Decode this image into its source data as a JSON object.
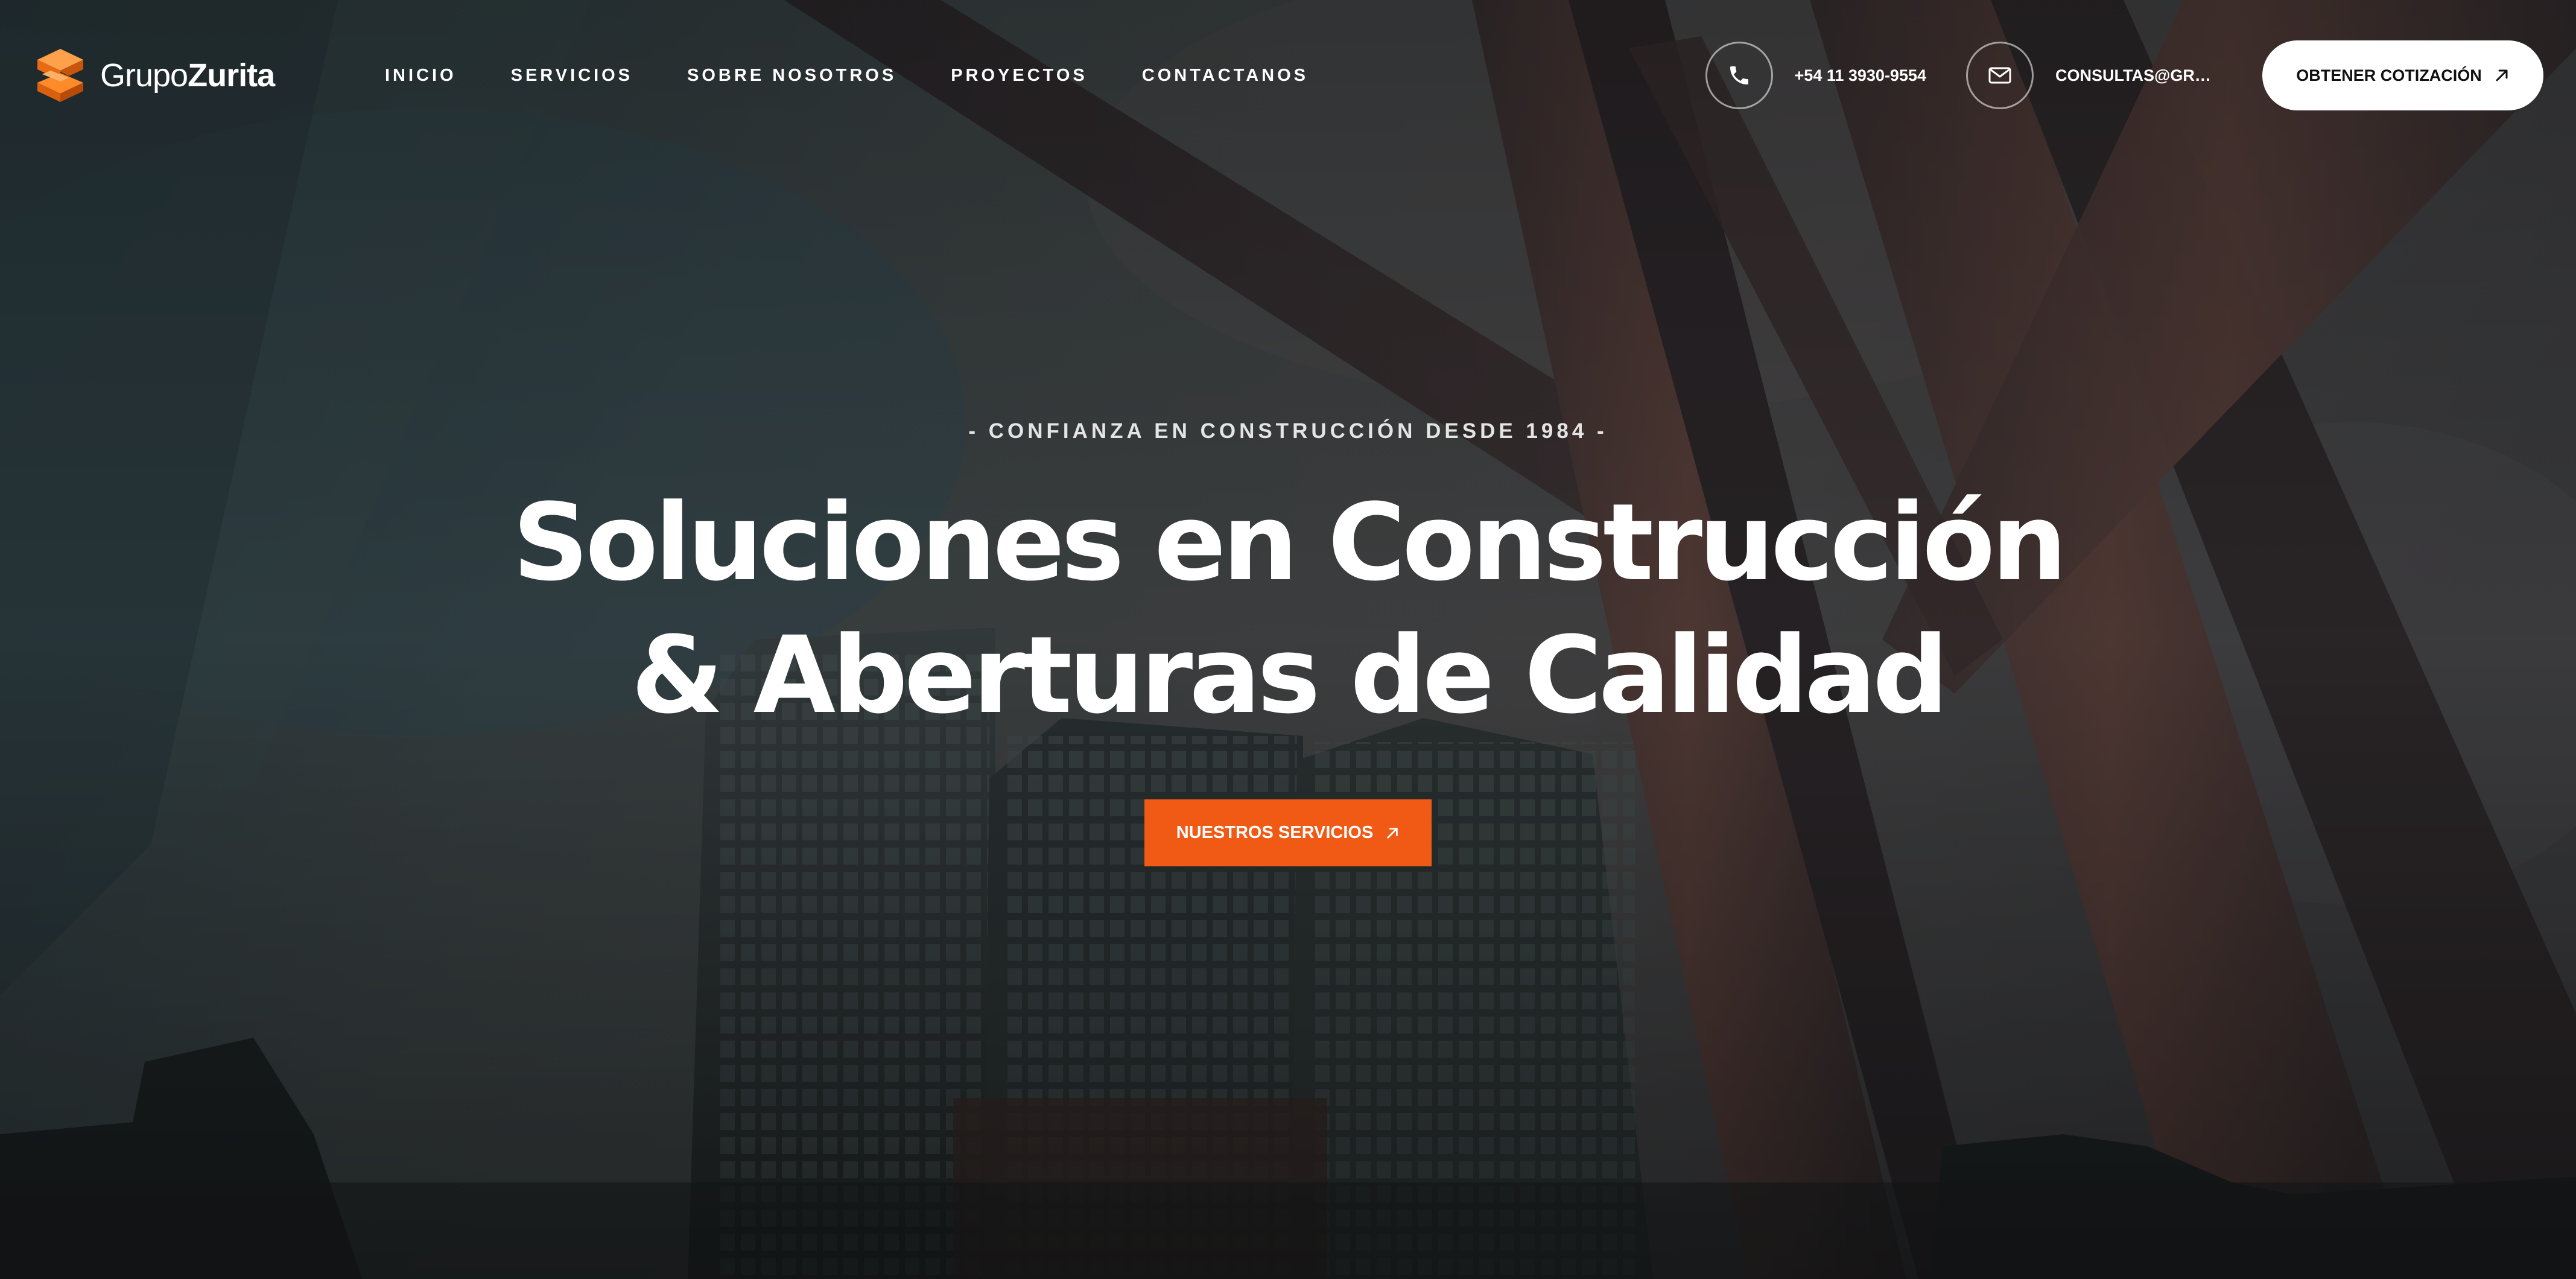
{
  "brand": {
    "name_light": "Grupo",
    "name_bold": "Zurita",
    "accent_color": "#f05a14",
    "logo_icon": "cube-stack-icon"
  },
  "nav": {
    "items": [
      {
        "label": "INICIO"
      },
      {
        "label": "SERVICIOS"
      },
      {
        "label": "SOBRE NOSOTROS"
      },
      {
        "label": "PROYECTOS"
      },
      {
        "label": "CONTACTANOS"
      }
    ]
  },
  "contact": {
    "phone": {
      "icon": "phone-icon",
      "text": "+54 11 3930-9554"
    },
    "email": {
      "icon": "mail-icon",
      "text": "CONSULTAS@GRUP..."
    }
  },
  "header": {
    "quote_button": {
      "label": "OBTENER COTIZACIÓN",
      "icon": "arrow-up-right-icon"
    }
  },
  "hero": {
    "tagline": "- CONFIANZA EN CONSTRUCCIÓN DESDE 1984 -",
    "headline_line1": "Soluciones en Construcción",
    "headline_line2": "& Aberturas de Calidad",
    "cta": {
      "label": "NUESTROS SERVICIOS",
      "icon": "arrow-up-right-icon",
      "color": "#f05a14"
    }
  }
}
